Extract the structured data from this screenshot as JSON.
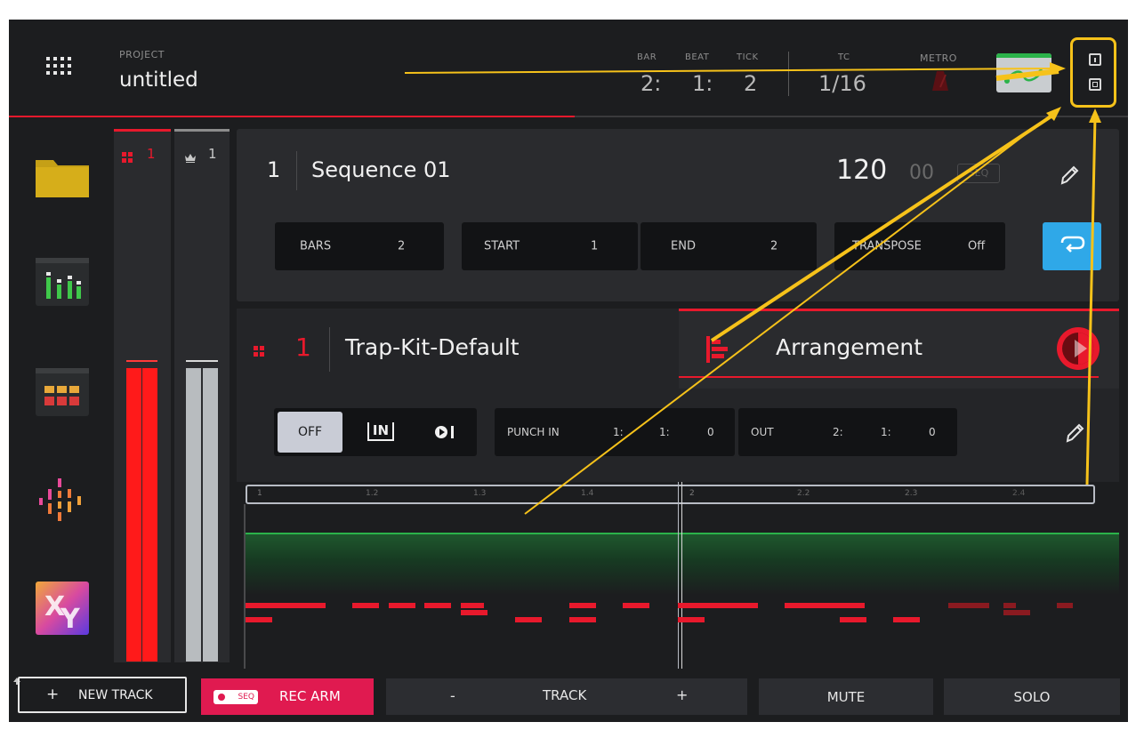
{
  "header": {
    "project_label": "PROJECT",
    "project_name": "untitled",
    "bar_label": "BAR",
    "beat_label": "BEAT",
    "tick_label": "TICK",
    "bar_value": "2:",
    "beat_value": "1:",
    "tick_value": "2",
    "tc_label": "TC",
    "tc_value": "1/16",
    "metro_label": "METRO"
  },
  "sidebar": {
    "items": [
      "folder-icon",
      "mixer-icon",
      "pad-mixer-icon",
      "sample-icon",
      "xy-fx-icon"
    ]
  },
  "meters": {
    "pad_label": "1",
    "master_label": "1",
    "left_level": 0.53,
    "right_level": 0.53,
    "left_color": "#ff1a1a",
    "right_color": "#b8bcbf"
  },
  "sequence": {
    "number": "1",
    "name": "Sequence 01",
    "bpm": "120",
    "bpm_decimal": "00",
    "seq_badge": "SEQ",
    "fields": [
      {
        "label": "BARS",
        "value": "2"
      },
      {
        "label": "START",
        "value": "1"
      },
      {
        "label": "END",
        "value": "2"
      },
      {
        "label": "TRANSPOSE",
        "value": "Off"
      }
    ]
  },
  "track": {
    "number": "1",
    "name": "Trap-Kit-Default",
    "arrangement_label": "Arrangement"
  },
  "record": {
    "off_label": "OFF",
    "in_label": "IN",
    "punch_in_label": "PUNCH IN",
    "punch_in_values": [
      "1:",
      "1:",
      "0"
    ],
    "out_label": "OUT",
    "out_values": [
      "2:",
      "1:",
      "0"
    ]
  },
  "timeline": {
    "ticks": [
      "1",
      "1.2",
      "1.3",
      "1.4",
      "2",
      "2.2",
      "2.3",
      "2.4"
    ]
  },
  "bottom_bar": {
    "new_track": "NEW TRACK",
    "plus": "+",
    "seq_badge": "SEQ",
    "rec_arm": "REC ARM",
    "minus": "-",
    "track": "TRACK",
    "track_plus": "+",
    "mute": "MUTE",
    "solo": "SOLO"
  },
  "colors": {
    "accent_red": "#e8192c",
    "loop_blue": "#2fa8e8",
    "highlight_yellow": "#f6c21a",
    "automation_green": "#2bb34a"
  }
}
